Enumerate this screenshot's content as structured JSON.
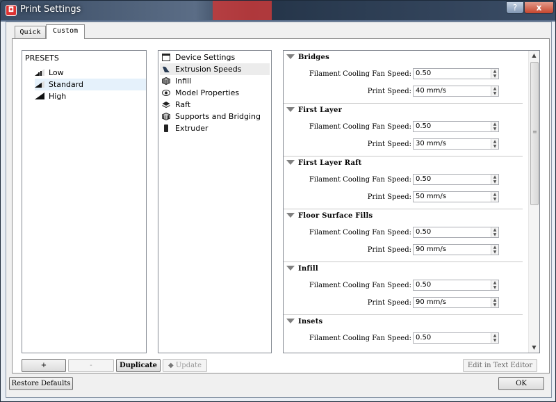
{
  "window": {
    "title": "Print Settings",
    "help_glyph": "?",
    "close_glyph": "x"
  },
  "tabs": [
    {
      "label": "Quick"
    },
    {
      "label": "Custom"
    }
  ],
  "presets": {
    "header": "PRESETS",
    "items": [
      {
        "label": "Low"
      },
      {
        "label": "Standard"
      },
      {
        "label": "High"
      }
    ]
  },
  "categories": [
    {
      "label": "Device Settings",
      "icon": "window-icon"
    },
    {
      "label": "Extrusion Speeds",
      "icon": "speed-icon"
    },
    {
      "label": "Infill",
      "icon": "infill-icon"
    },
    {
      "label": "Model Properties",
      "icon": "eye-icon"
    },
    {
      "label": "Raft",
      "icon": "layers-icon"
    },
    {
      "label": "Supports and Bridging",
      "icon": "grid-icon"
    },
    {
      "label": "Extruder",
      "icon": "extruder-icon"
    }
  ],
  "sections": [
    {
      "title": "Bridges",
      "fields": [
        {
          "label": "Filament Cooling Fan Speed:",
          "value": "0.50"
        },
        {
          "label": "Print Speed:",
          "value": "40 mm/s"
        }
      ]
    },
    {
      "title": "First Layer",
      "fields": [
        {
          "label": "Filament Cooling Fan Speed:",
          "value": "0.50"
        },
        {
          "label": "Print Speed:",
          "value": "30 mm/s"
        }
      ]
    },
    {
      "title": "First Layer Raft",
      "fields": [
        {
          "label": "Filament Cooling Fan Speed:",
          "value": "0.50"
        },
        {
          "label": "Print Speed:",
          "value": "50 mm/s"
        }
      ]
    },
    {
      "title": "Floor Surface Fills",
      "fields": [
        {
          "label": "Filament Cooling Fan Speed:",
          "value": "0.50"
        },
        {
          "label": "Print Speed:",
          "value": "90 mm/s"
        }
      ]
    },
    {
      "title": "Infill",
      "fields": [
        {
          "label": "Filament Cooling Fan Speed:",
          "value": "0.50"
        },
        {
          "label": "Print Speed:",
          "value": "90 mm/s"
        }
      ]
    },
    {
      "title": "Insets",
      "fields": [
        {
          "label": "Filament Cooling Fan Speed:",
          "value": "0.50"
        }
      ]
    }
  ],
  "scroll": {
    "up_glyph": "▲",
    "down_glyph": "▼",
    "grip_glyph": "≡"
  },
  "buttons": {
    "add": "+",
    "remove": "-",
    "duplicate": "Duplicate",
    "update": "Update",
    "edit_text": "Edit in Text Editor",
    "restore": "Restore Defaults",
    "ok": "OK"
  }
}
